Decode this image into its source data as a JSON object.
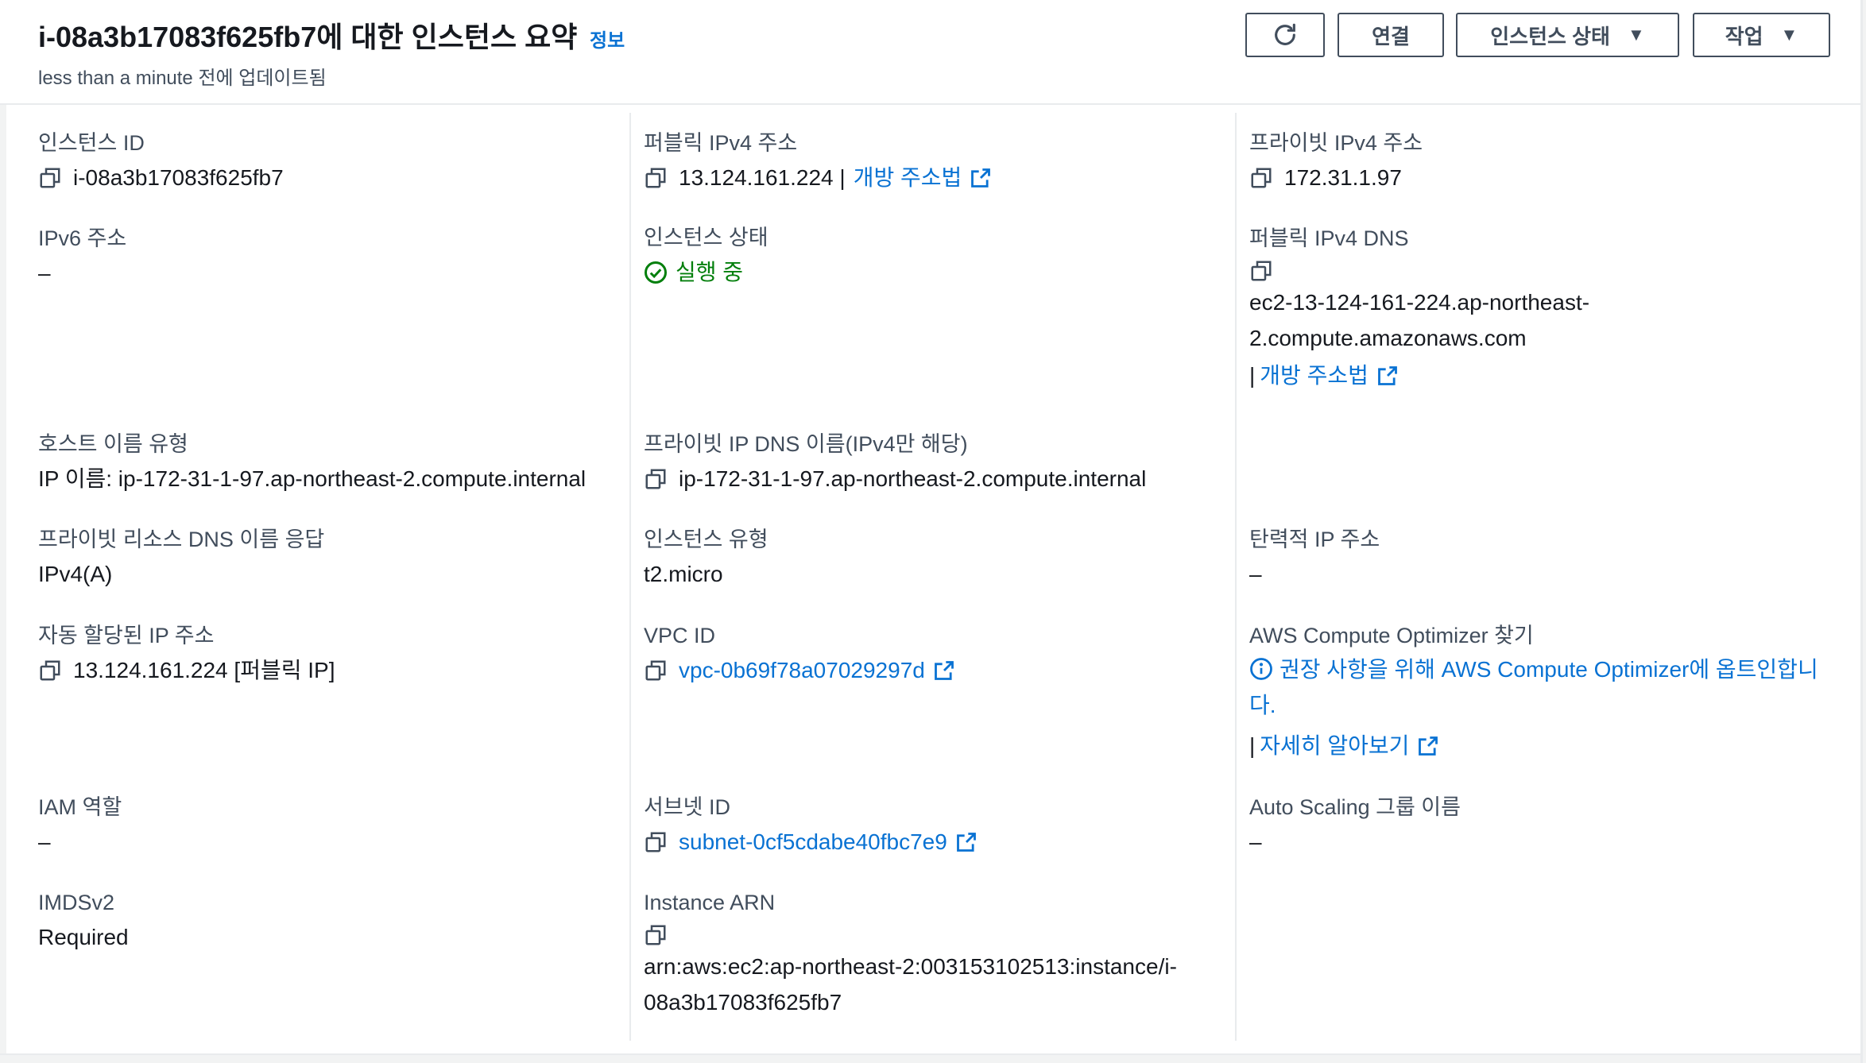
{
  "header": {
    "title": "i-08a3b17083f625fb7에 대한 인스턴스 요약",
    "info_link": "정보",
    "subtitle": "less than a minute 전에 업데이트됨",
    "buttons": {
      "refresh_icon": "refresh-icon",
      "connect": "연결",
      "instance_state": "인스턴스 상태",
      "actions": "작업"
    }
  },
  "fields": {
    "instance_id": {
      "label": "인스턴스 ID",
      "value": "i-08a3b17083f625fb7"
    },
    "public_ipv4": {
      "label": "퍼블릭 IPv4 주소",
      "value": "13.124.161.224 |",
      "link": "개방 주소법"
    },
    "private_ipv4": {
      "label": "프라이빗 IPv4 주소",
      "value": "172.31.1.97"
    },
    "ipv6": {
      "label": "IPv6 주소",
      "value": "–"
    },
    "instance_state": {
      "label": "인스턴스 상태",
      "value": "실행 중"
    },
    "public_dns": {
      "label": "퍼블릭 IPv4 DNS",
      "line1": "ec2-13-124-161-224.ap-northeast-",
      "line2": "2.compute.amazonaws.com",
      "prefix": "|",
      "link": "개방 주소법"
    },
    "hostname_type": {
      "label": "호스트 이름 유형",
      "value": "IP 이름: ip-172-31-1-97.ap-northeast-2.compute.internal"
    },
    "private_dns": {
      "label": "프라이빗 IP DNS 이름(IPv4만 해당)",
      "value": "ip-172-31-1-97.ap-northeast-2.compute.internal"
    },
    "resource_dns": {
      "label": "프라이빗 리소스 DNS 이름 응답",
      "value": "IPv4(A)"
    },
    "instance_type": {
      "label": "인스턴스 유형",
      "value": "t2.micro"
    },
    "elastic_ip": {
      "label": "탄력적 IP 주소",
      "value": "–"
    },
    "auto_ip": {
      "label": "자동 할당된 IP 주소",
      "value": "13.124.161.224 [퍼블릭 IP]"
    },
    "vpc_id": {
      "label": "VPC ID",
      "value": "vpc-0b69f78a07029297d"
    },
    "optimizer": {
      "label": "AWS Compute Optimizer 찾기",
      "line1": "권장 사항을 위해 AWS Compute Optimizer에 옵트인합니",
      "line2": "다.",
      "prefix": "|",
      "link": "자세히 알아보기"
    },
    "iam_role": {
      "label": "IAM 역할",
      "value": "–"
    },
    "subnet_id": {
      "label": "서브넷 ID",
      "value": "subnet-0cf5cdabe40fbc7e9"
    },
    "asg_name": {
      "label": "Auto Scaling 그룹 이름",
      "value": "–"
    },
    "imdsv2": {
      "label": "IMDSv2",
      "value": "Required"
    },
    "instance_arn": {
      "label": "Instance ARN",
      "line1": "arn:aws:ec2:ap-northeast-2:003153102513:instance/i-",
      "line2": "08a3b17083f625fb7"
    }
  },
  "colors": {
    "link": "#0972d3",
    "success": "#037f0c",
    "text": "#16191f",
    "label": "#414d5c"
  }
}
